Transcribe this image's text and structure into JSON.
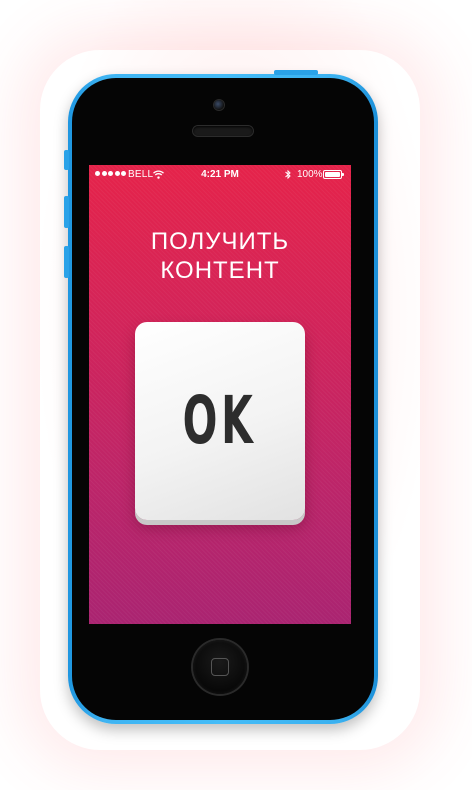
{
  "status_bar": {
    "carrier": "BELL",
    "time": "4:21 PM",
    "battery_percent": "100%",
    "battery_level": 1.0,
    "signal_bars": 5,
    "icons": [
      "signal-dots-icon",
      "wifi-icon",
      "bluetooth-icon",
      "battery-icon"
    ]
  },
  "content": {
    "headline_line1": "ПОЛУЧИТЬ",
    "headline_line2": "КОНТЕНТ",
    "ok_button_label": "OK"
  },
  "colors": {
    "screen_top": "#e5234a",
    "screen_bottom": "#aa2471",
    "phone_body": "#45bcf7",
    "button_text": "#2d2d2d"
  }
}
